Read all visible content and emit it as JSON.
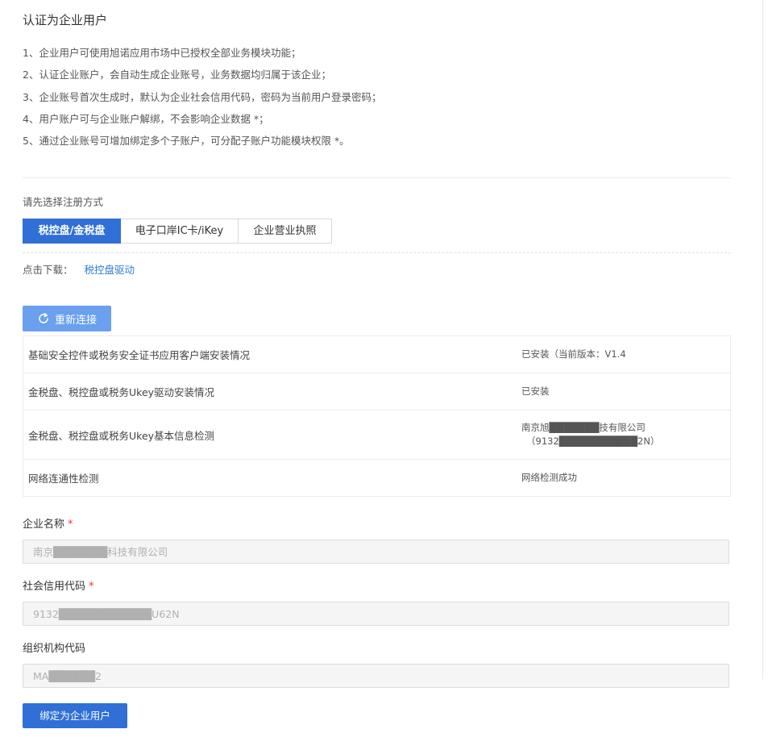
{
  "page_title": "认证为企业用户",
  "notes": [
    "1、企业用户可使用旭诺应用市场中已授权全部业务模块功能；",
    "2、认证企业账户，会自动生成企业账号，业务数据均归属于该企业；",
    "3、企业账号首次生成时，默认为企业社会信用代码，密码为当前用户登录密码；",
    "4、用户账户可与企业账户解绑，不会影响企业数据 *；",
    "5、通过企业账号可增加绑定多个子账户，可分配子账户功能模块权限 *。"
  ],
  "register_method_label": "请先选择注册方式",
  "tabs": [
    {
      "label": "税控盘/金税盘",
      "active": true
    },
    {
      "label": "电子口岸IC卡/iKey",
      "active": false
    },
    {
      "label": "企业营业执照",
      "active": false
    }
  ],
  "download": {
    "label": "点击下载：",
    "link_text": "税控盘驱动"
  },
  "reconnect_button": {
    "icon": "refresh-icon",
    "label": "重新连接"
  },
  "checks": [
    {
      "name": "基础安全控件或税务安全证书应用客户端安装情况",
      "status": "已安装（当前版本：V1.4",
      "status_sub": ""
    },
    {
      "name": "金税盘、税控盘或税务Ukey驱动安装情况",
      "status": "已安装",
      "status_sub": ""
    },
    {
      "name": "金税盘、税控盘或税务Ukey基本信息检测",
      "status": "南京旭███████技有限公司",
      "status_sub": "（9132███████████2N）"
    },
    {
      "name": "网络连通性检测",
      "status": "网络检测成功",
      "status_sub": ""
    }
  ],
  "fields": {
    "company_name": {
      "label": "企业名称",
      "required_mark": "*",
      "value": "南京███████科技有限公司"
    },
    "credit_code": {
      "label": "社会信用代码",
      "required_mark": "*",
      "value": "9132████████████U62N"
    },
    "org_code": {
      "label": "组织机构代码",
      "value": "MA██████2"
    }
  },
  "submit_button": {
    "label": "绑定为企业用户"
  },
  "colors": {
    "primary": "#2f6fd6",
    "reconnect": "#6aa0ee",
    "link": "#2f7fd6",
    "required": "#e0393e"
  }
}
